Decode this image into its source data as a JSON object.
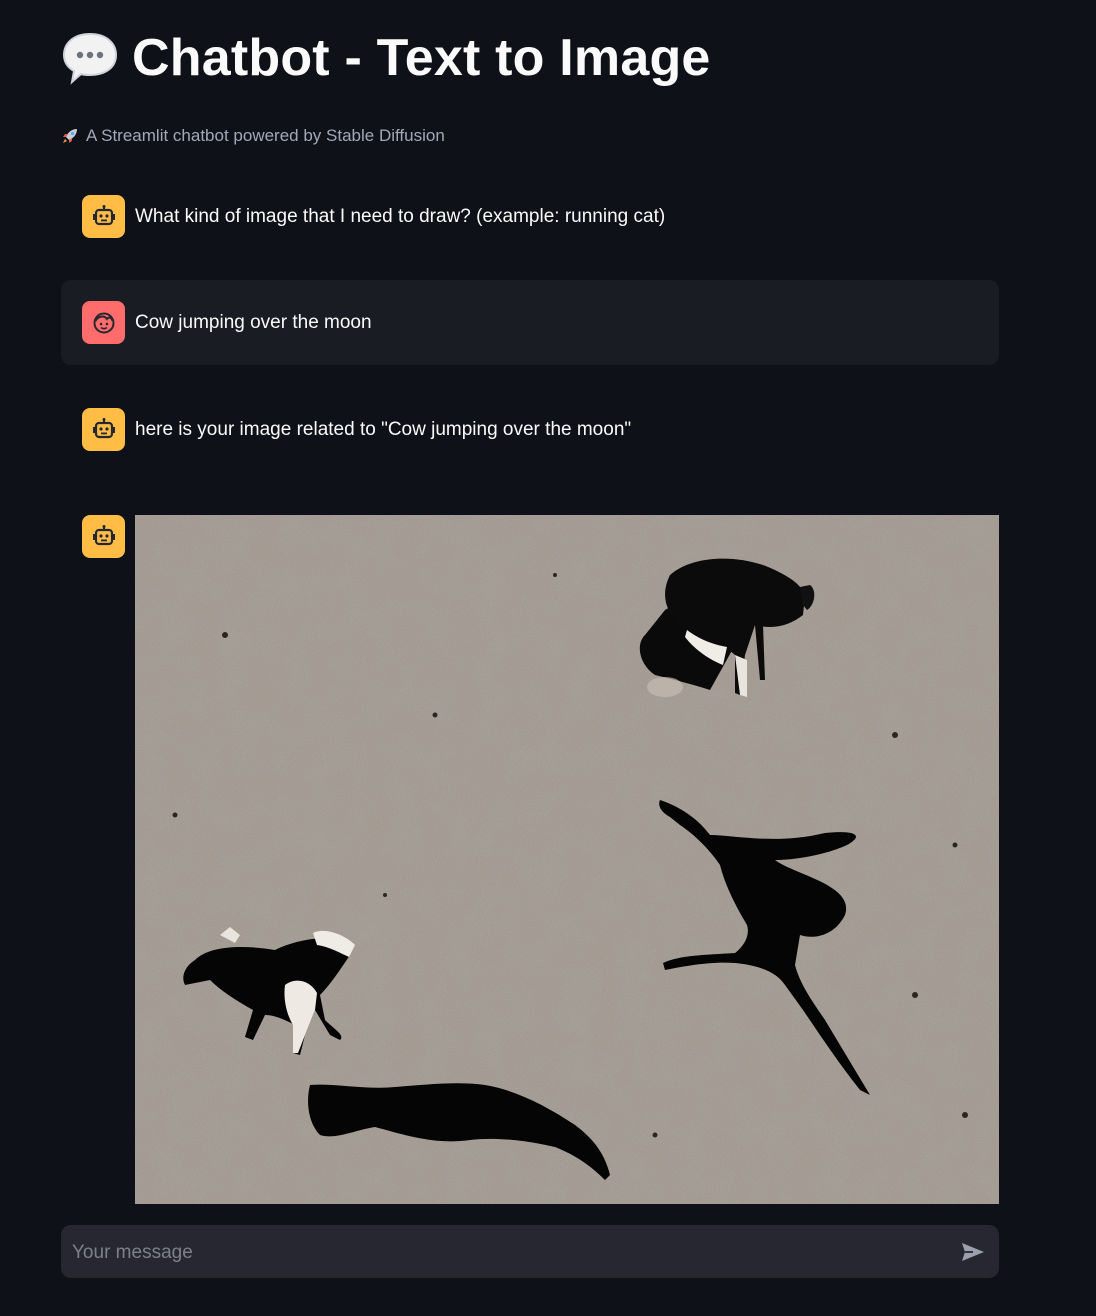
{
  "header": {
    "title": "Chatbot - Text to Image",
    "title_icon": "speech-balloon-icon",
    "caption": "A Streamlit chatbot powered by Stable Diffusion",
    "caption_icon": "rocket-icon"
  },
  "messages": [
    {
      "role": "assistant",
      "avatar": "robot-icon",
      "text": "What kind of image that I need to draw? (example: running cat)"
    },
    {
      "role": "user",
      "avatar": "face-icon",
      "text": "Cow jumping over the moon"
    },
    {
      "role": "assistant",
      "avatar": "robot-icon",
      "text": "here is your image related to \"Cow jumping over the moon\""
    },
    {
      "role": "assistant",
      "avatar": "robot-icon",
      "image": "generated image: cows and shadows on lunar surface"
    }
  ],
  "chat_input": {
    "placeholder": "Your message",
    "send_icon": "send-icon"
  },
  "colors": {
    "background": "#0e1117",
    "assistant_avatar": "#ffbd45",
    "user_avatar": "#ff6c6c",
    "user_bubble": "#1a1c24",
    "input_bg": "#262730"
  }
}
